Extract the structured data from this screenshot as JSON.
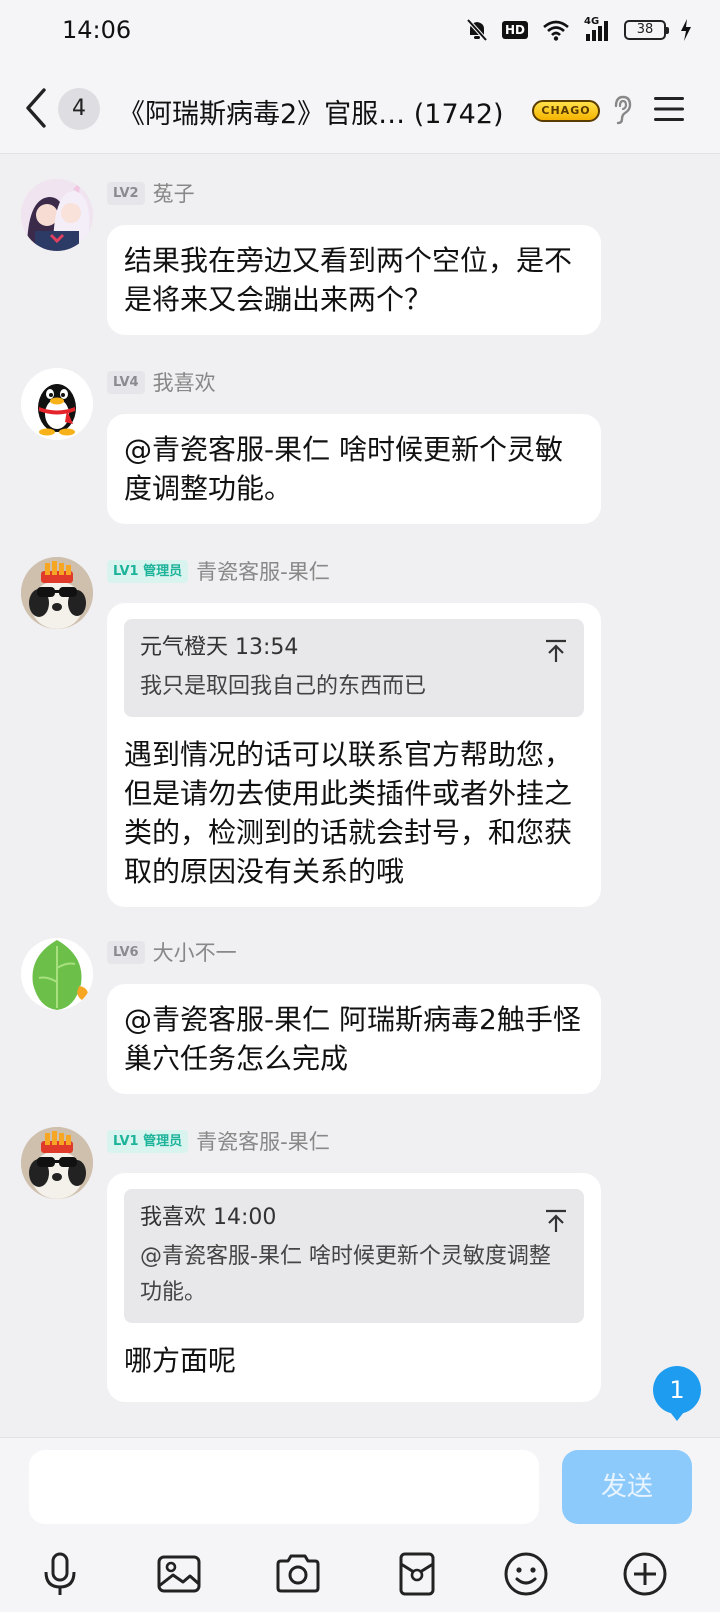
{
  "status_bar": {
    "time": "14:06",
    "battery": "38",
    "hd": "HD",
    "network": "4G"
  },
  "header": {
    "unread_count": "4",
    "title": "《阿瑞斯病毒2》官服… (1742)",
    "badge": "CHAGO"
  },
  "messages": [
    {
      "level": "LV2",
      "sender": "菟子",
      "text": "结果我在旁边又看到两个空位，是不是将来又会蹦出来两个？"
    },
    {
      "level": "LV4",
      "sender": "我喜欢",
      "text": "@青瓷客服-果仁 啥时候更新个灵敏度调整功能。"
    },
    {
      "level": "LV1 管理员",
      "sender": "青瓷客服-果仁",
      "quote": {
        "author_time": "元气橙天 13:54",
        "text": "我只是取回我自己的东西而已"
      },
      "text": "遇到情况的话可以联系官方帮助您，但是请勿去使用此类插件或者外挂之类的，检测到的话就会封号，和您获取的原因没有关系的哦"
    },
    {
      "level": "LV6",
      "sender": "大小不一",
      "text": "@青瓷客服-果仁 阿瑞斯病毒2触手怪巢穴任务怎么完成"
    },
    {
      "level": "LV1 管理员",
      "sender": "青瓷客服-果仁",
      "quote": {
        "author_time": "我喜欢 14:00",
        "text": "@青瓷客服-果仁 啥时候更新个灵敏度调整功能。"
      },
      "text": "哪方面呢"
    }
  ],
  "new_message_count": "1",
  "input": {
    "placeholder": "",
    "send_label": "发送"
  },
  "toolbar": [
    "mic-icon",
    "image-icon",
    "camera-icon",
    "red-packet-icon",
    "emoji-icon",
    "plus-icon"
  ],
  "colors": {
    "accent": "#1e9cf0",
    "send_disabled": "#8ccafc",
    "admin_badge": "#1db39a"
  }
}
